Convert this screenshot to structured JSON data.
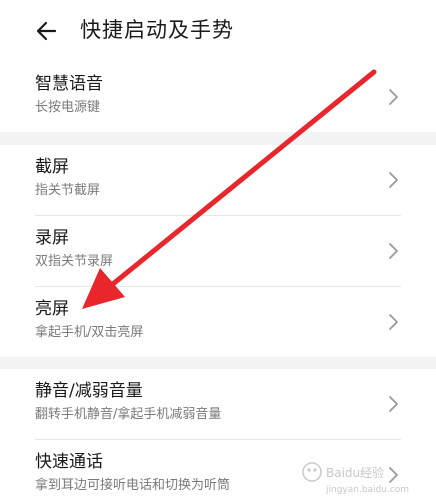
{
  "header": {
    "title": "快捷启动及手势",
    "back_icon": "arrow-left-icon"
  },
  "sections": [
    {
      "items": [
        {
          "title": "智慧语音",
          "subtitle": "长按电源键"
        }
      ]
    },
    {
      "items": [
        {
          "title": "截屏",
          "subtitle": "指关节截屏"
        },
        {
          "title": "录屏",
          "subtitle": "双指关节录屏"
        },
        {
          "title": "亮屏",
          "subtitle": "拿起手机/双击亮屏"
        }
      ]
    },
    {
      "items": [
        {
          "title": "静音/减弱音量",
          "subtitle": "翻转手机静音/拿起手机减弱音量"
        },
        {
          "title": "快速通话",
          "subtitle": "拿到耳边可接听电话和切换为听筒"
        }
      ]
    }
  ],
  "annotation": {
    "color": "#e8262b",
    "icon": "red-arrow-icon"
  },
  "watermark": {
    "text": "Baidu经验",
    "sub": "jingyan.baidu.com",
    "color": "#c8c8c8"
  },
  "colors": {
    "background": "#ffffff",
    "section_gap": "#f1f3f5",
    "subtitle": "#7a7a7a",
    "divider": "#e6e6e6"
  }
}
